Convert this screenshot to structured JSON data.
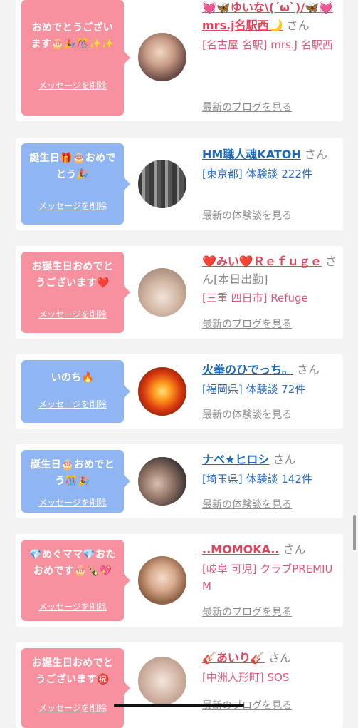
{
  "cards": [
    {
      "message": "おめでとうございます🎂🎉🎊✨✨",
      "delete_label": "メッセージを削除",
      "name": "💓🦋ゆいな\\(´ω`)/🦋💓mrs.j名駅西🌙",
      "san": "さん",
      "meta": "[名古屋 名駅] mrs.J 名駅西",
      "link": "最新のブログを見る",
      "bubble_color": "#f7919f"
    },
    {
      "message": "誕生日🎁🎂おめでとう🎉",
      "delete_label": "メッセージを削除",
      "name": "HM職人魂KATOH",
      "san": "さん",
      "meta": "[東京都] 体験談 222件",
      "link": "最新の体験談を見る",
      "bubble_color": "#8fb5f2"
    },
    {
      "message": "お誕生日おめでとうございます❤️",
      "delete_label": "メッセージを削除",
      "name": "❤️みい❤️Ｒｅｆｕｇｅ",
      "san": "さん[本日出勤]",
      "meta": "[三重 四日市] Refuge",
      "link": "最新のブログを見る",
      "bubble_color": "#f7919f"
    },
    {
      "message": "いのち🔥",
      "delete_label": "メッセージを削除",
      "name": "火拳のひでっち。",
      "san": "さん",
      "meta": "[福岡県] 体験談 72件",
      "link": "最新の体験談を見る",
      "bubble_color": "#8fb5f2"
    },
    {
      "message": "誕生日🎂おめでとう🎊🎉",
      "delete_label": "メッセージを削除",
      "name": "ナベ★ヒロシ",
      "san": "さん",
      "meta": "[埼玉県] 体験談 142件",
      "link": "最新の体験談を見る",
      "bubble_color": "#8fb5f2"
    },
    {
      "message": "💎めぐママ💎おたおめです🎂🍾💖",
      "delete_label": "メッセージを削除",
      "name": "..MOMOKA..",
      "san": "さん",
      "meta": "[岐阜 可児] クラブPREMIUM",
      "link": "最新のブログを見る",
      "bubble_color": "#f7919f"
    },
    {
      "message": "お誕生日おめでとうございます㊗️",
      "delete_label": "メッセージを削除",
      "name": "🎸あいり🎸",
      "san": "さん",
      "meta": "[中洲人形町] SOS",
      "link": "最新のブログを見る",
      "bubble_color": "#f7919f"
    }
  ]
}
